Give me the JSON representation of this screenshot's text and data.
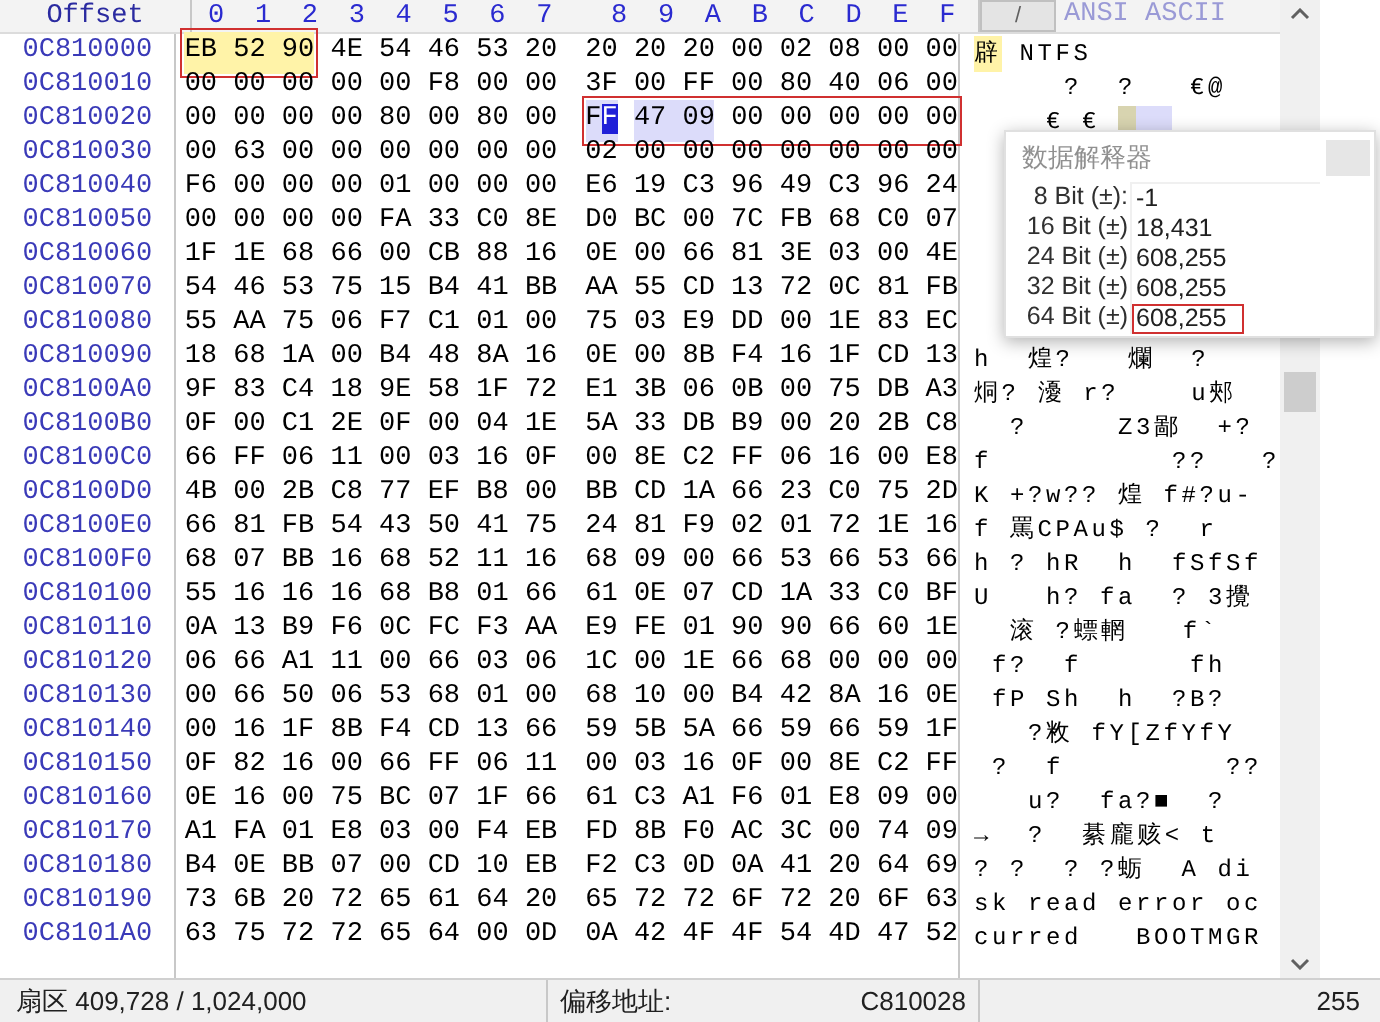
{
  "header": {
    "offset_title": "Offset",
    "columns": [
      "0",
      "1",
      "2",
      "3",
      "4",
      "5",
      "6",
      "7",
      "8",
      "9",
      "A",
      "B",
      "C",
      "D",
      "E",
      "F"
    ],
    "ansi_title": "ANSI ASCII",
    "ansi_button": "/"
  },
  "rows": [
    {
      "offset": "0C810000",
      "left": [
        {
          "kind": "frame",
          "children": [
            {
              "kind": "block",
              "text": "EB 52 90"
            }
          ]
        },
        {
          "kind": "plain",
          "text": "4E 54 46 53 20"
        }
      ],
      "right": [
        {
          "kind": "plain",
          "text": "20 20 20 00 02 08 00 00"
        }
      ],
      "ansi": [
        {
          "kind": "block",
          "text": "辟"
        },
        {
          "kind": "plain",
          "text": " NTFS"
        }
      ]
    },
    {
      "offset": "0C810010",
      "left": [
        {
          "kind": "plain",
          "text": "00 00 00 00 00 F8 00 00"
        }
      ],
      "right": [
        {
          "kind": "plain",
          "text": "3F 00 FF 00 80 40 06 00"
        }
      ],
      "ansi": [
        {
          "kind": "plain",
          "text": "     ?  ?   €@"
        }
      ]
    },
    {
      "offset": "0C810020",
      "left": [
        {
          "kind": "plain",
          "text": "00 00 00 00 80 00 80 00"
        }
      ],
      "right": [
        {
          "kind": "frame",
          "children": [
            {
              "kind": "cursor",
              "text": "FF"
            },
            {
              "kind": "selected",
              "text": "47 09"
            },
            {
              "kind": "plain",
              "text": "00 00 00 00 00"
            }
          ]
        }
      ],
      "ansi": [
        {
          "kind": "plain",
          "text": "    € € "
        },
        {
          "kind": "cursor"
        },
        {
          "kind": "selected"
        }
      ]
    },
    {
      "offset": "0C810030",
      "left": [
        {
          "kind": "plain",
          "text": "00 63 00 00 00 00 00 00"
        }
      ],
      "right": [
        {
          "kind": "plain",
          "text": "02 00 00 00 00 00 00 00"
        }
      ],
      "ansi": []
    },
    {
      "offset": "0C810040",
      "left": [
        {
          "kind": "plain",
          "text": "F6 00 00 00 01 00 00 00"
        }
      ],
      "right": [
        {
          "kind": "plain",
          "text": "E6 19 C3 96 49 C3 96 24"
        }
      ],
      "ansi": []
    },
    {
      "offset": "0C810050",
      "left": [
        {
          "kind": "plain",
          "text": "00 00 00 00 FA 33 C0 8E"
        }
      ],
      "right": [
        {
          "kind": "plain",
          "text": "D0 BC 00 7C FB 68 C0 07"
        }
      ],
      "ansi": []
    },
    {
      "offset": "0C810060",
      "left": [
        {
          "kind": "plain",
          "text": "1F 1E 68 66 00 CB 88 16"
        }
      ],
      "right": [
        {
          "kind": "plain",
          "text": "0E 00 66 81 3E 03 00 4E"
        }
      ],
      "ansi": []
    },
    {
      "offset": "0C810070",
      "left": [
        {
          "kind": "plain",
          "text": "54 46 53 75 15 B4 41 BB"
        }
      ],
      "right": [
        {
          "kind": "plain",
          "text": "AA 55 CD 13 72 0C 81 FB"
        }
      ],
      "ansi": []
    },
    {
      "offset": "0C810080",
      "left": [
        {
          "kind": "plain",
          "text": "55 AA 75 06 F7 C1 01 00"
        }
      ],
      "right": [
        {
          "kind": "plain",
          "text": "75 03 E9 DD 00 1E 83 EC"
        }
      ],
      "ansi": []
    },
    {
      "offset": "0C810090",
      "left": [
        {
          "kind": "plain",
          "text": "18 68 1A 00 B4 48 8A 16"
        }
      ],
      "right": [
        {
          "kind": "plain",
          "text": "0E 00 8B F4 16 1F CD 13"
        }
      ],
      "ansi": [
        {
          "kind": "plain",
          "text": "h  煌?   爛  ?"
        }
      ]
    },
    {
      "offset": "0C8100A0",
      "left": [
        {
          "kind": "plain",
          "text": "9F 83 C4 18 9E 58 1F 72"
        }
      ],
      "right": [
        {
          "kind": "plain",
          "text": "E1 3B 06 0B 00 75 DB A3"
        }
      ],
      "ansi": [
        {
          "kind": "plain",
          "text": "烔? 瀀 r?    u郟"
        }
      ]
    },
    {
      "offset": "0C8100B0",
      "left": [
        {
          "kind": "plain",
          "text": "0F 00 C1 2E 0F 00 04 1E"
        }
      ],
      "right": [
        {
          "kind": "plain",
          "text": "5A 33 DB B9 00 20 2B C8"
        }
      ],
      "ansi": [
        {
          "kind": "plain",
          "text": "  ?     Z3鄙  +?"
        }
      ]
    },
    {
      "offset": "0C8100C0",
      "left": [
        {
          "kind": "plain",
          "text": "66 FF 06 11 00 03 16 0F"
        }
      ],
      "right": [
        {
          "kind": "plain",
          "text": "00 8E C2 FF 06 16 00 E8"
        }
      ],
      "ansi": [
        {
          "kind": "plain",
          "text": "f          ??   ?"
        }
      ]
    },
    {
      "offset": "0C8100D0",
      "left": [
        {
          "kind": "plain",
          "text": "4B 00 2B C8 77 EF B8 00"
        }
      ],
      "right": [
        {
          "kind": "plain",
          "text": "BB CD 1A 66 23 C0 75 2D"
        }
      ],
      "ansi": [
        {
          "kind": "plain",
          "text": "K +?w?? 煌 f#?u-"
        }
      ]
    },
    {
      "offset": "0C8100E0",
      "left": [
        {
          "kind": "plain",
          "text": "66 81 FB 54 43 50 41 75"
        }
      ],
      "right": [
        {
          "kind": "plain",
          "text": "24 81 F9 02 01 72 1E 16"
        }
      ],
      "ansi": [
        {
          "kind": "plain",
          "text": "f 罵CPAu$ ?  r"
        }
      ]
    },
    {
      "offset": "0C8100F0",
      "left": [
        {
          "kind": "plain",
          "text": "68 07 BB 16 68 52 11 16"
        }
      ],
      "right": [
        {
          "kind": "plain",
          "text": "68 09 00 66 53 66 53 66"
        }
      ],
      "ansi": [
        {
          "kind": "plain",
          "text": "h ? hR  h  fSfSf"
        }
      ]
    },
    {
      "offset": "0C810100",
      "left": [
        {
          "kind": "plain",
          "text": "55 16 16 16 68 B8 01 66"
        }
      ],
      "right": [
        {
          "kind": "plain",
          "text": "61 0E 07 CD 1A 33 C0 BF"
        }
      ],
      "ansi": [
        {
          "kind": "plain",
          "text": "U   h? fa  ? 3攪"
        }
      ]
    },
    {
      "offset": "0C810110",
      "left": [
        {
          "kind": "plain",
          "text": "0A 13 B9 F6 0C FC F3 AA"
        }
      ],
      "right": [
        {
          "kind": "plain",
          "text": "E9 FE 01 90 90 66 60 1E"
        }
      ],
      "ansi": [
        {
          "kind": "plain",
          "text": "  滚 ?螵輞   f`"
        }
      ]
    },
    {
      "offset": "0C810120",
      "left": [
        {
          "kind": "plain",
          "text": "06 66 A1 11 00 66 03 06"
        }
      ],
      "right": [
        {
          "kind": "plain",
          "text": "1C 00 1E 66 68 00 00 00"
        }
      ],
      "ansi": [
        {
          "kind": "plain",
          "text": " f?  f      fh"
        }
      ]
    },
    {
      "offset": "0C810130",
      "left": [
        {
          "kind": "plain",
          "text": "00 66 50 06 53 68 01 00"
        }
      ],
      "right": [
        {
          "kind": "plain",
          "text": "68 10 00 B4 42 8A 16 0E"
        }
      ],
      "ansi": [
        {
          "kind": "plain",
          "text": " fP Sh  h  ?B?"
        }
      ]
    },
    {
      "offset": "0C810140",
      "left": [
        {
          "kind": "plain",
          "text": "00 16 1F 8B F4 CD 13 66"
        }
      ],
      "right": [
        {
          "kind": "plain",
          "text": "59 5B 5A 66 59 66 59 1F"
        }
      ],
      "ansi": [
        {
          "kind": "plain",
          "text": "   ?敉 fY[ZfYfY"
        }
      ]
    },
    {
      "offset": "0C810150",
      "left": [
        {
          "kind": "plain",
          "text": "0F 82 16 00 66 FF 06 11"
        }
      ],
      "right": [
        {
          "kind": "plain",
          "text": "00 03 16 0F 00 8E C2 FF"
        }
      ],
      "ansi": [
        {
          "kind": "plain",
          "text": " ?  f         ??"
        }
      ]
    },
    {
      "offset": "0C810160",
      "left": [
        {
          "kind": "plain",
          "text": "0E 16 00 75 BC 07 1F 66"
        }
      ],
      "right": [
        {
          "kind": "plain",
          "text": "61 C3 A1 F6 01 E8 09 00"
        }
      ],
      "ansi": [
        {
          "kind": "plain",
          "text": "   u?  fa?■  ?"
        }
      ]
    },
    {
      "offset": "0C810170",
      "left": [
        {
          "kind": "plain",
          "text": "A1 FA 01 E8 03 00 F4 EB"
        }
      ],
      "right": [
        {
          "kind": "plain",
          "text": "FD 8B F0 AC 3C 00 74 09"
        }
      ],
      "ansi": [
        {
          "kind": "plain",
          "text": "→  ?  綦龐赅< t"
        }
      ]
    },
    {
      "offset": "0C810180",
      "left": [
        {
          "kind": "plain",
          "text": "B4 0E BB 07 00 CD 10 EB"
        }
      ],
      "right": [
        {
          "kind": "plain",
          "text": "F2 C3 0D 0A 41 20 64 69"
        }
      ],
      "ansi": [
        {
          "kind": "plain",
          "text": "? ?  ? ?蛎  A di"
        }
      ]
    },
    {
      "offset": "0C810190",
      "left": [
        {
          "kind": "plain",
          "text": "73 6B 20 72 65 61 64 20"
        }
      ],
      "right": [
        {
          "kind": "plain",
          "text": "65 72 72 6F 72 20 6F 63"
        }
      ],
      "ansi": [
        {
          "kind": "plain",
          "text": "sk read error oc"
        }
      ]
    },
    {
      "offset": "0C8101A0",
      "left": [
        {
          "kind": "plain",
          "text": "63 75 72 72 65 64 00 0D"
        }
      ],
      "right": [
        {
          "kind": "plain",
          "text": "0A 42 4F 4F 54 4D 47 52"
        }
      ],
      "ansi": [
        {
          "kind": "plain",
          "text": "curred   BOOTMGR"
        }
      ]
    }
  ],
  "interpreter": {
    "title": "数据解释器",
    "rows": [
      {
        "label": "8 Bit (±):",
        "value": "-1",
        "framed": false
      },
      {
        "label": "16 Bit (±)",
        "value": "18,431",
        "framed": false
      },
      {
        "label": "24 Bit (±)",
        "value": "608,255",
        "framed": false
      },
      {
        "label": "32 Bit (±)",
        "value": "608,255",
        "framed": false
      },
      {
        "label": "64 Bit (±)",
        "value": "608,255",
        "framed": true
      }
    ]
  },
  "status_bar": {
    "sector": "扇区 409,728 / 1,024,000",
    "offset_label": "偏移地址:",
    "offset_value": "C810028",
    "value": "255"
  }
}
